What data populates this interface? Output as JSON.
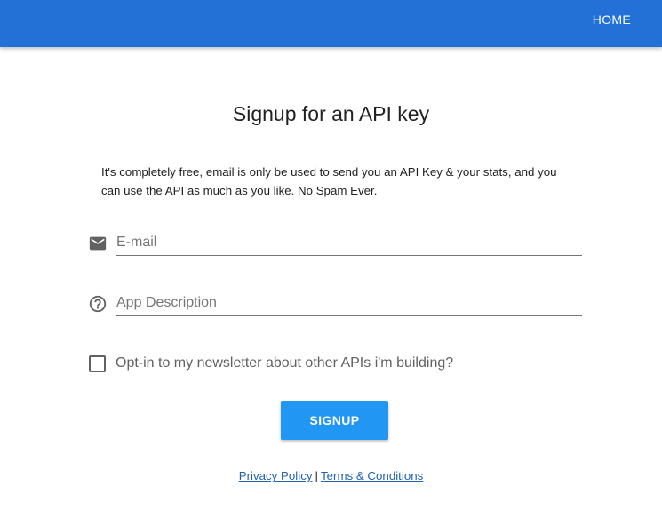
{
  "nav": {
    "home_label": "HOME",
    "bar_color": "#2370d6"
  },
  "page": {
    "title": "Signup for an API key",
    "intro": "It's completely free, email is only be used to send you an API Key & your stats, and you can use the API as much as you like. No Spam Ever."
  },
  "form": {
    "email": {
      "icon": "email-icon",
      "placeholder": "E-mail",
      "value": ""
    },
    "description": {
      "icon": "help-circle-icon",
      "placeholder": "App Description",
      "value": ""
    },
    "newsletter": {
      "label": "Opt-in to my newsletter about other APIs i'm building?",
      "checked": false
    },
    "submit_label": "SIGNUP",
    "submit_color": "#2196f3"
  },
  "footer": {
    "privacy_label": "Privacy Policy",
    "separator": "|",
    "terms_label": "Terms & Conditions"
  }
}
